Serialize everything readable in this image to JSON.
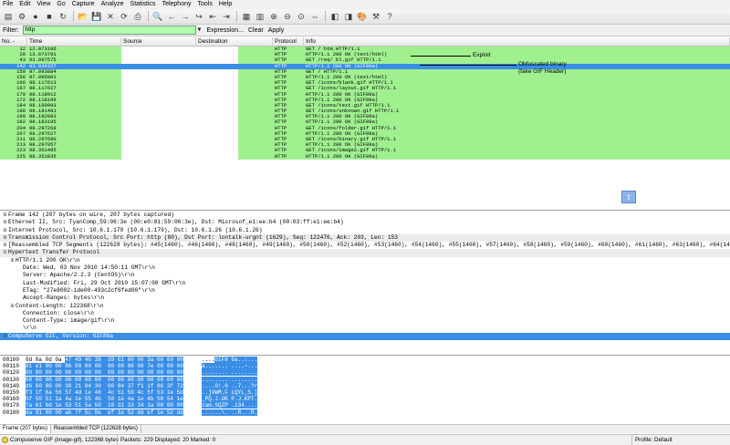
{
  "menu": [
    "File",
    "Edit",
    "View",
    "Go",
    "Capture",
    "Analyze",
    "Statistics",
    "Telephony",
    "Tools",
    "Help"
  ],
  "toolbar_icons": [
    "interface-list-icon",
    "capture-options-icon",
    "start-capture-icon",
    "stop-capture-icon",
    "restart-capture-icon",
    "open-file-icon",
    "save-file-icon",
    "close-file-icon",
    "reload-icon",
    "print-icon",
    "find-packet-icon",
    "go-back-icon",
    "go-forward-icon",
    "go-to-packet-icon",
    "first-packet-icon",
    "last-packet-icon",
    "colorize-icon",
    "auto-scroll-icon",
    "zoom-in-icon",
    "zoom-out-icon",
    "normal-size-icon",
    "resize-columns-icon",
    "capture-filters-icon",
    "display-filters-icon",
    "coloring-rules-icon",
    "preferences-icon",
    "help-icon"
  ],
  "filter": {
    "label": "Filter:",
    "value": "http",
    "expression": "Expression...",
    "clear": "Clear",
    "apply": "Apply",
    "color": "#afffaf"
  },
  "columns": [
    "No. -",
    "Time",
    "Source",
    "Destination",
    "Protocol",
    "Info"
  ],
  "packets": [
    {
      "no": "12",
      "time": "12.073186",
      "proto": "HTTP",
      "info": "GET /       htm HTTP/1.1"
    },
    {
      "no": "28",
      "time": "13.073791",
      "proto": "HTTP",
      "info": "HTTP/1.1 200 OK  (text/html)"
    },
    {
      "no": "43",
      "time": "93.897575",
      "proto": "HTTP",
      "info": "GET /req/     bl.gif HTTP/1.1"
    },
    {
      "no": "142",
      "time": "93.934157",
      "proto": "HTTP",
      "info": "HTTP/1.1 200 OK  (GIF89a)",
      "selected": true
    },
    {
      "no": "150",
      "time": "97.093884",
      "proto": "HTTP",
      "info": "GET / HTTP/1.1"
    },
    {
      "no": "156",
      "time": "97.095901",
      "proto": "HTTP",
      "info": "HTTP/1.1 200 OK  (text/html)"
    },
    {
      "no": "166",
      "time": "98.117613",
      "proto": "HTTP",
      "info": "GET /icons/blank.gif HTTP/1.1"
    },
    {
      "no": "167",
      "time": "98.117627",
      "proto": "HTTP",
      "info": "GET /icons/layout.gif HTTP/1.1"
    },
    {
      "no": "170",
      "time": "98.118012",
      "proto": "HTTP",
      "info": "HTTP/1.1 200 OK  (GIF89a)"
    },
    {
      "no": "172",
      "time": "98.118199",
      "proto": "HTTP",
      "info": "HTTP/1.1 200 OK  (GIF89a)"
    },
    {
      "no": "184",
      "time": "98.180993",
      "proto": "HTTP",
      "info": "GET /icons/text.gif HTTP/1.1"
    },
    {
      "no": "188",
      "time": "98.181481",
      "proto": "HTTP",
      "info": "GET /icons/unknown.gif HTTP/1.1"
    },
    {
      "no": "190",
      "time": "98.182983",
      "proto": "HTTP",
      "info": "HTTP/1.1 200 OK  (GIF89a)"
    },
    {
      "no": "192",
      "time": "98.183195",
      "proto": "HTTP",
      "info": "HTTP/1.1 200 OK  (GIF89a)"
    },
    {
      "no": "204",
      "time": "98.297268",
      "proto": "HTTP",
      "info": "GET /icons/folder.gif HTTP/1.1"
    },
    {
      "no": "207",
      "time": "98.297627",
      "proto": "HTTP",
      "info": "HTTP/1.1 200 OK  (GIF89a)"
    },
    {
      "no": "211",
      "time": "98.297690",
      "proto": "HTTP",
      "info": "GET /icons/binary.gif HTTP/1.1"
    },
    {
      "no": "213",
      "time": "98.297957",
      "proto": "HTTP",
      "info": "HTTP/1.1 200 OK  (GIF89a)"
    },
    {
      "no": "223",
      "time": "98.351485",
      "proto": "HTTP",
      "info": "GET /icons/image2.gif HTTP/1.1"
    },
    {
      "no": "225",
      "time": "98.351835",
      "proto": "HTTP",
      "info": "HTTP/1.1 200 OK  (GIF89a)"
    }
  ],
  "annotations": {
    "exploit": "Exploit",
    "obfuscated_1": "Obfuscated binary",
    "obfuscated_2": "(fake GIF Header)"
  },
  "details": [
    {
      "exp": "⊞",
      "text": "Frame 142 (207 bytes on wire, 207 bytes captured)",
      "indent": 0
    },
    {
      "exp": "⊞",
      "text": "Ethernet II, Src: TyanComp_59:06:3e (00:e0:81:59:06:3e), Dst: Microsof_e1:ee:b4 (00:03:ff:e1:ee:b4)",
      "indent": 0
    },
    {
      "exp": "⊞",
      "text": "Internet Protocol, Src: 10.6.1.179 (10.6.1.179), Dst: 10.6.1.26 (10.6.1.26)",
      "indent": 0
    },
    {
      "exp": "⊞",
      "text": "Transmission Control Protocol, Src Port: http (80), Dst Port: lontalk-urgnt (1629), Seq: 122476, Ack: 203, Len: 153",
      "indent": 0,
      "hl": true
    },
    {
      "exp": "⊞",
      "text": "[Reassembled TCP Segments (122628 bytes): #45(1460), #46(1460), #48(1460), #49(1460), #50(1460), #52(1460), #53(1460), #54(1460), #55(1460), #57(1460), #58(1460), #59(1460), #60(1460), #61(1460), #63(1460), #64(1460)]",
      "indent": 0
    },
    {
      "exp": "⊟",
      "text": "Hypertext Transfer Protocol",
      "indent": 0,
      "hl": true
    },
    {
      "exp": "⊞",
      "text": "HTTP/1.1 200 OK\\r\\n",
      "indent": 1
    },
    {
      "exp": "",
      "text": "Date: Wed, 03 Nov 2010 14:50:11 GMT\\r\\n",
      "indent": 2
    },
    {
      "exp": "",
      "text": "Server: Apache/2.2.3 (CentOS)\\r\\n",
      "indent": 2
    },
    {
      "exp": "",
      "text": "Last-Modified: Fri, 29 Oct 2010 15:07:00 GMT\\r\\n",
      "indent": 2
    },
    {
      "exp": "",
      "text": "ETag: \"27e8002-1de00-493c2cf6fed00\"\\r\\n",
      "indent": 2
    },
    {
      "exp": "",
      "text": "Accept-Ranges: bytes\\r\\n",
      "indent": 2
    },
    {
      "exp": "⊞",
      "text": "Content-Length: 122368\\r\\n",
      "indent": 1
    },
    {
      "exp": "",
      "text": "Connection: close\\r\\n",
      "indent": 2
    },
    {
      "exp": "",
      "text": "Content-Type: image/gif\\r\\n",
      "indent": 2
    },
    {
      "exp": "",
      "text": "\\r\\n",
      "indent": 2
    },
    {
      "exp": "⊞",
      "text": "CompuServe GIF, Version: GIF89a",
      "indent": 0,
      "sel": true
    }
  ],
  "hex": [
    {
      "off": "00100",
      "pre": "0d 0a 0d 0a ",
      "sel": "47 49 46 38  39 61 00 00 3a 00 00 00",
      "asc_pre": "....",
      "asc_sel": "GIF8 9a..:..."
    },
    {
      "off": "00110",
      "pre": "",
      "sel": "61 e1 00 00 86 00 00 00  00 00 00 00 7e 00 00 00",
      "asc_pre": "",
      "asc_sel": "a....... ....~..."
    },
    {
      "off": "00120",
      "pre": "",
      "sel": "00 00 00 00 00 00 00 00  00 00 00 00 00 00 00 00",
      "asc_pre": "",
      "asc_sel": "........ ........"
    },
    {
      "off": "00130",
      "pre": "",
      "sel": "00 00 00 00 00 00 00 00  00 00 00 00 00 00 00 00",
      "asc_pre": "",
      "asc_sel": "........ ........"
    },
    {
      "off": "00140",
      "pre": "",
      "sel": "d6 00 00 00 30 21 84 30  00 84 37 f1 1f 86 3f 72",
      "asc_pre": "",
      "asc_sel": "....0!.0 ..7...?r"
    },
    {
      "off": "00150",
      "pre": "",
      "sel": "f3 1f 6a 56 57 4d 1e 46  4c 51 59 4c 5f 53 1e 5d",
      "asc_pre": "",
      "asc_sel": "..jVWM.F LQYL_S.]"
    },
    {
      "off": "00160",
      "pre": "",
      "sel": "5f 50 51 1a 4a 1e 55 4b  50 1e 4a 1e 4b 50 54 1e",
      "asc_pre": "",
      "asc_sel": "_PQ.J.UK P.J.KPT."
    },
    {
      "off": "00170",
      "pre": "",
      "sel": "7a 61 6d 1e 53 51 5a 50  10 31 33 34 1a 00 00 00",
      "asc_pre": "",
      "asc_sel": "zam.SQZP .134...."
    },
    {
      "off": "00180",
      "pre": "",
      "sel": "da 91 00 00 ab 7f 5c 8e  ef 1e 52 dd ef 1e 52 dd",
      "asc_pre": "",
      "asc_sel": "......\\. ..R...R."
    }
  ],
  "byte_tabs": [
    "Frame (207 bytes)",
    "Reassembled TCP (122628 bytes)"
  ],
  "status": {
    "left": "Compuserve GIF (image-gif), 122368 bytes",
    "mid": "Packets: 229 Displayed: 20 Marked: 0",
    "right": "Profile: Default"
  }
}
